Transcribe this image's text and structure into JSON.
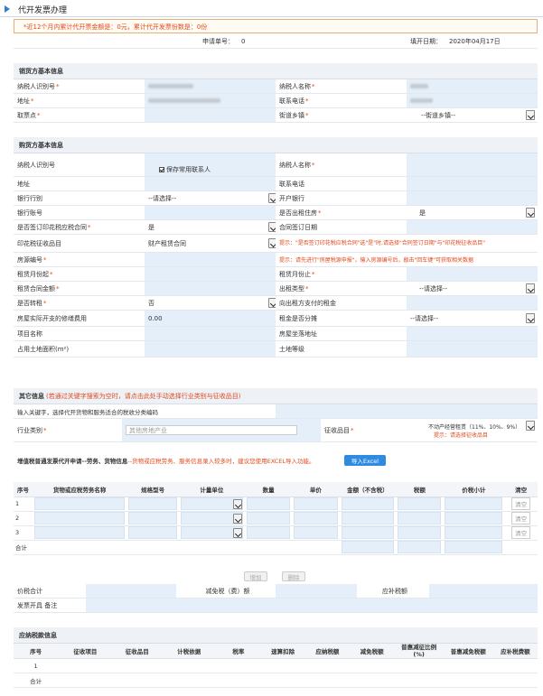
{
  "page": {
    "title": "代开发票办理"
  },
  "notice": "*近12个月内累计代开票金额是：0元，累计代开发票份数是：0份",
  "apply": {
    "no_label": "申请单号：",
    "no_value": "0",
    "date_label": "填开日期：",
    "date_value": "2020年04月17日"
  },
  "seller": {
    "title": "销货方基本信息",
    "tax_id_label": "纳税人识别号",
    "name_label": "纳税人名称",
    "address_label": "地址",
    "phone_label": "联系电话",
    "pickup_label": "取票点",
    "street_label": "街道乡镇",
    "street_value": "--街道乡镇--"
  },
  "buyer": {
    "title": "购货方基本信息",
    "tax_id_label": "纳税人识别号",
    "save_contact": "保存常用联系人",
    "name_label": "纳税人名称",
    "address_label": "地址",
    "phone_label": "联系电话",
    "bank_label": "银行行别",
    "bank_value": "--请选择--",
    "open_bank_label": "开户银行",
    "account_label": "银行账号",
    "rent_house_label": "是否出租住房",
    "rent_house_value": "是",
    "stamp_contract_label": "是否签订印花税应税合同",
    "stamp_contract_value": "是",
    "contract_date_label": "合同签订日期",
    "stamp_item_label": "印花税征收品目",
    "stamp_item_value": "财产租赁合同",
    "stamp_hint": "提示：\"是否签订印花税应税合同\"选\"是\"时,请选择\"合同签订日期\"与\"印花税征收品目\"",
    "house_no_label": "房源编号",
    "house_hint": "提示：请先进行\"房屋税源申报\"，输入房源编号后，敲击\"回车键\"可获取相关数据",
    "rent_start_label": "租赁月份起",
    "rent_end_label": "租赁月份止",
    "rent_amount_label": "租赁合同金额",
    "rent_type_label": "出租类型",
    "rent_type_value": "--请选择--",
    "transfer_label": "是否转租",
    "transfer_value": "否",
    "paid_rent_label": "向出租方支付的租金",
    "repair_label": "房屋实际开支的修缮费用",
    "repair_value": "0.00",
    "rent_free_label": "租金是否分摊",
    "rent_free_value": "--请选择--",
    "project_label": "项目名称",
    "location_label": "房屋坐落地址",
    "land_area_label": "占用土地面积(m²)",
    "land_grade_label": "土地等级"
  },
  "other": {
    "title": "其它信息",
    "hint": "(若通过关键字搜索为空时，请点击此处手动选择行业类别与征收品目)",
    "keyword_label": "输入关键字，选择代开货物和服务适合的税收分类编码",
    "industry_label": "行业类别",
    "industry_placeholder": "其他房地产业",
    "levy_label": "征收品目",
    "levy_value": "不动产经营租赁（11%、10%、9%）",
    "levy_hint": "提示：请选择征收品目"
  },
  "goods": {
    "title": "增值税普通发票代开申请--劳务、货物信息",
    "hint": "--货物或应税劳务、服务信息录入较多时，建议您使用EXCEL导入功能。",
    "import_button": "导入Excel",
    "headers": [
      "序号",
      "货物或应税劳务名称",
      "规格型号",
      "计量单位",
      "数量",
      "单价",
      "金额（不含税）",
      "税额",
      "价税小计",
      "清空"
    ],
    "rows": [
      {
        "no": "1",
        "clear": "清空"
      },
      {
        "no": "2",
        "clear": "清空"
      },
      {
        "no": "3",
        "clear": "清空"
      }
    ],
    "total_label": "合计",
    "add_button": "增加",
    "delete_button": "删除"
  },
  "summary": {
    "tax_total_label": "价税合计",
    "reduce_label": "减免税（费）额",
    "supplement_label": "应补税额",
    "remark_label": "发票开具 备注"
  },
  "payable": {
    "title": "应纳税款信息",
    "headers": [
      "序号",
      "征收项目",
      "征收品目",
      "计税依据",
      "税率",
      "速算扣除",
      "应纳税额",
      "减免税额",
      "普惠减征比例(%)",
      "普惠减免税额",
      "应补税费额"
    ],
    "row_no": "1",
    "total_label": "合计"
  }
}
